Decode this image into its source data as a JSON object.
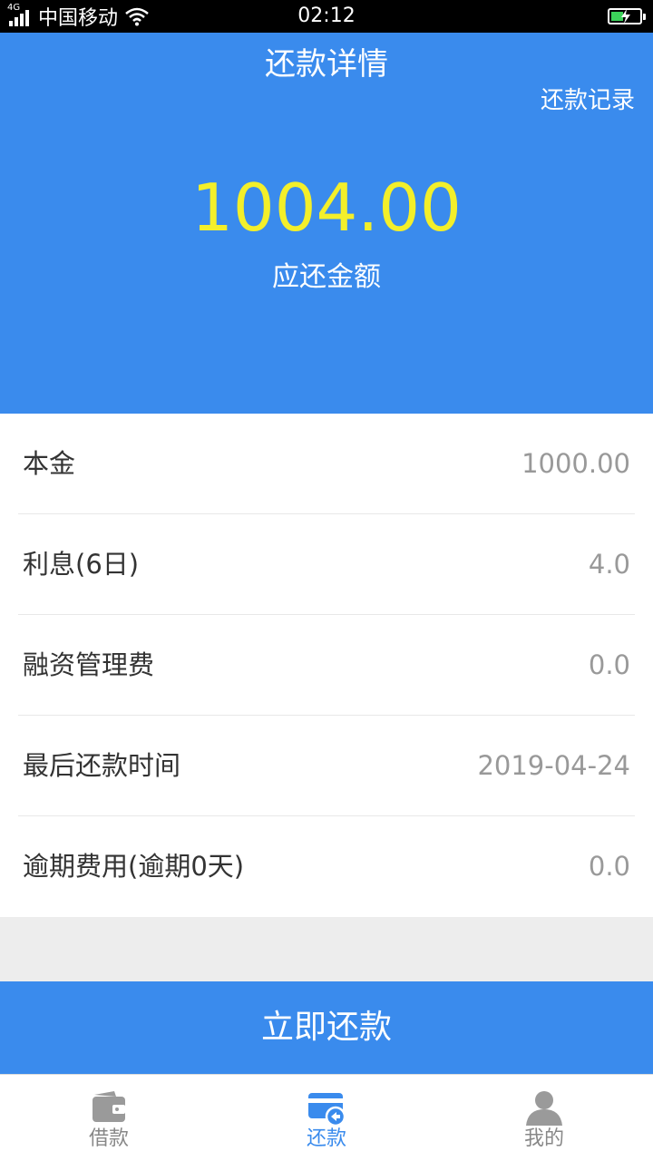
{
  "status_bar": {
    "network": "4G",
    "carrier": "中国移动",
    "time": "02:12",
    "icons": [
      "signal-icon",
      "wifi-icon",
      "battery-charging-icon"
    ]
  },
  "header": {
    "title": "还款详情",
    "records_link": "还款记录",
    "amount": "1004.00",
    "amount_label": "应还金额",
    "background_color": "#3a8bed",
    "amount_color": "#f3ef2a"
  },
  "details": [
    {
      "label": "本金",
      "value": "1000.00"
    },
    {
      "label": "利息(6日)",
      "value": "4.0"
    },
    {
      "label": "融资管理费",
      "value": "0.0"
    },
    {
      "label": "最后还款时间",
      "value": "2019-04-24"
    },
    {
      "label": "逾期费用(逾期0天)",
      "value": "0.0"
    }
  ],
  "pay_button": {
    "label": "立即还款"
  },
  "tabs": [
    {
      "label": "借款",
      "icon": "wallet-icon",
      "active": false
    },
    {
      "label": "还款",
      "icon": "card-return-icon",
      "active": true
    },
    {
      "label": "我的",
      "icon": "person-icon",
      "active": false
    }
  ],
  "colors": {
    "primary": "#3a8bed",
    "inactive_tab": "#888888",
    "value_text": "#999999"
  }
}
